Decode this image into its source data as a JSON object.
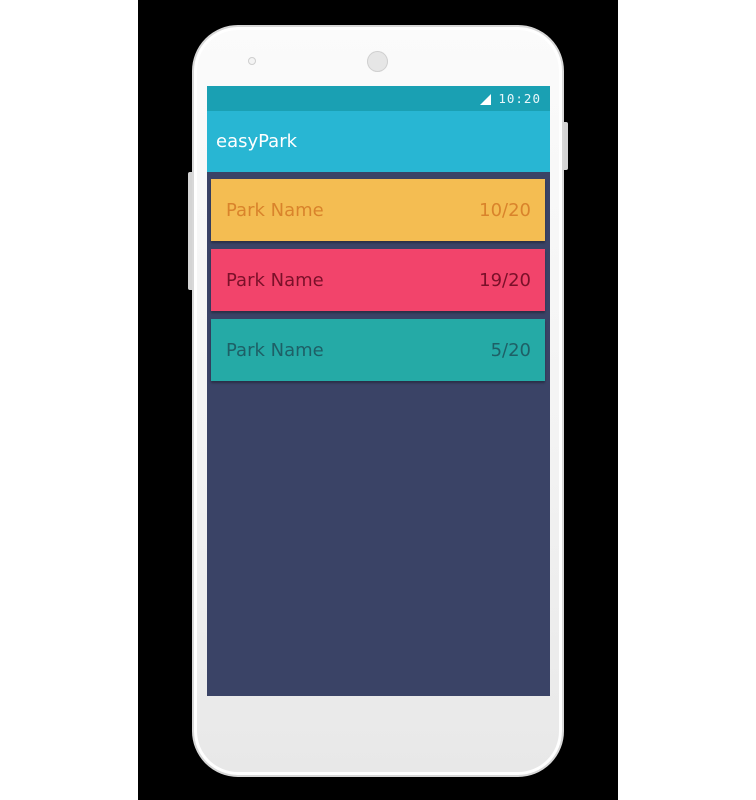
{
  "status_bar": {
    "time": "10:20",
    "signal_icon": "signal-icon",
    "color": "#1aa0b3"
  },
  "app_bar": {
    "title": "easyPark",
    "color": "#28b6d3"
  },
  "screen": {
    "background": "#3a4366"
  },
  "parks": [
    {
      "name": "Park Name",
      "count": "10/20",
      "background": "#f4bd52",
      "text_color": "#d9832b"
    },
    {
      "name": "Park Name",
      "count": "19/20",
      "background": "#f2446b",
      "text_color": "#7a1029"
    },
    {
      "name": "Park Name",
      "count": "5/20",
      "background": "#25aaa6",
      "text_color": "#1e5f66"
    }
  ]
}
